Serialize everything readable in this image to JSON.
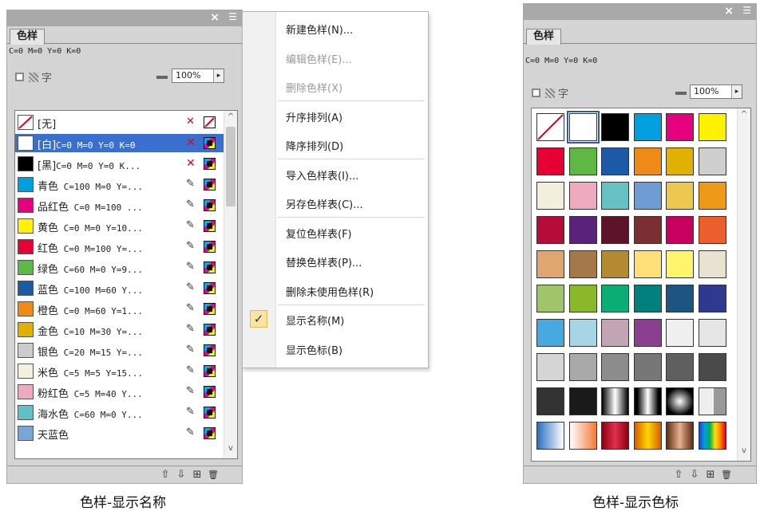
{
  "panel_title_icons": "×",
  "tab_label": "色样",
  "cmyk_readout": "C=0 M=0 Y=0 K=0",
  "tint_char": "字",
  "tint_value": "100%",
  "scroll_up": "^",
  "scroll_down": "v",
  "footer": {
    "up": "⇧",
    "down": "⇩",
    "new": "⊞",
    "trash": "🗑"
  },
  "left_caption": "色样-显示名称",
  "right_caption": "色样-显示色标",
  "swatches": [
    {
      "name": "[无]",
      "detail": "",
      "color": "none",
      "icon": "none"
    },
    {
      "name": "[白]",
      "detail": "C=0 M=0 Y=0 K=0",
      "color": "#ffffff",
      "icon": "locked"
    },
    {
      "name": "[黑]",
      "detail": "C=0 M=0 Y=0 K...",
      "color": "#000000",
      "icon": "locked"
    },
    {
      "name": "青色",
      "detail": " C=100 M=0 Y=...",
      "color": "#00a0e0",
      "icon": "pencil"
    },
    {
      "name": "品红色",
      "detail": " C=0 M=100 ...",
      "color": "#e6007e",
      "icon": "pencil"
    },
    {
      "name": "黄色",
      "detail": " C=0 M=0 Y=10...",
      "color": "#fff100",
      "icon": "pencil"
    },
    {
      "name": "红色",
      "detail": " C=0 M=100 Y=...",
      "color": "#e60033",
      "icon": "pencil"
    },
    {
      "name": "绿色",
      "detail": " C=60 M=0 Y=9...",
      "color": "#5fb846",
      "icon": "pencil"
    },
    {
      "name": "蓝色",
      "detail": " C=100 M=60 Y...",
      "color": "#1d5aa6",
      "icon": "pencil"
    },
    {
      "name": "橙色",
      "detail": " C=0 M=60 Y=1...",
      "color": "#ef8a16",
      "icon": "pencil"
    },
    {
      "name": "金色",
      "detail": " C=10 M=30 Y=...",
      "color": "#e1b000",
      "icon": "pencil"
    },
    {
      "name": "银色",
      "detail": " C=20 M=15 Y=...",
      "color": "#cccccc",
      "icon": "pencil"
    },
    {
      "name": "米色",
      "detail": " C=5 M=5 Y=15...",
      "color": "#f4f0de",
      "icon": "pencil"
    },
    {
      "name": "粉红色",
      "detail": " C=5 M=40 Y...",
      "color": "#eeabc0",
      "icon": "pencil"
    },
    {
      "name": "海水色",
      "detail": " C=60 M=0 Y...",
      "color": "#62c1c4",
      "icon": "pencil"
    },
    {
      "name": "天蓝色",
      "detail": "",
      "color": "#78a6d9",
      "icon": "pencil"
    }
  ],
  "menu": [
    {
      "label": "新建色样(N)...",
      "disabled": false
    },
    {
      "label": "编辑色样(E)...",
      "disabled": true
    },
    {
      "label": "删除色样(X)",
      "disabled": true
    },
    {
      "label": "升序排列(A)",
      "disabled": false
    },
    {
      "label": "降序排列(D)",
      "disabled": false
    },
    {
      "label": "导入色样表(I)...",
      "disabled": false
    },
    {
      "label": "另存色样表(C)...",
      "disabled": false
    },
    {
      "label": "复位色样表(F)",
      "disabled": false
    },
    {
      "label": "替换色样表(P)...",
      "disabled": false
    },
    {
      "label": "删除未使用色样(R)",
      "disabled": false
    },
    {
      "label": "显示名称(M)",
      "disabled": false,
      "checked": true
    },
    {
      "label": "显示色标(B)",
      "disabled": false
    }
  ],
  "grid_colors": [
    [
      "none",
      "#ffffff",
      "#000000",
      "#00a0e0",
      "#e6007e",
      "#fff100"
    ],
    [
      "#e60033",
      "#5fb846",
      "#1d5aa6",
      "#ef8a16",
      "#e1b000",
      "#d0cfcf"
    ],
    [
      "#f2f0dc",
      "#eeabc0",
      "#66c1c3",
      "#6f9cd4",
      "#edc84f",
      "#ee9a17"
    ],
    [
      "#b50c3a",
      "#5a2279",
      "#5b1428",
      "#7a3030",
      "#c8005e",
      "#ea5f2c"
    ],
    [
      "#dfa66f",
      "#a5784a",
      "#b48b32",
      "#ffdf78",
      "#fff56a",
      "#e8e2d0"
    ],
    [
      "#9fc46a",
      "#89b92b",
      "#0aad73",
      "#00807d",
      "#1c5680",
      "#2e3a8e"
    ],
    [
      "#47aadf",
      "#a6d6e6",
      "#c2a5b4",
      "#8c3f91",
      "#f0f0f0",
      "#e6e6e6"
    ],
    [
      "#d5d5d5",
      "#a9a9a9",
      "#8c8c8c",
      "#777777",
      "#5f5f5f",
      "#4a4a4a"
    ],
    [
      "#333333",
      "#1a1a1a",
      "grad-gray-h",
      "grad-gray-mid",
      "grad-radial",
      "grad-gray-right"
    ],
    [
      "grad-blue",
      "grad-orange",
      "grad-red",
      "grad-yellow",
      "grad-copper",
      "grad-rainbow"
    ]
  ]
}
